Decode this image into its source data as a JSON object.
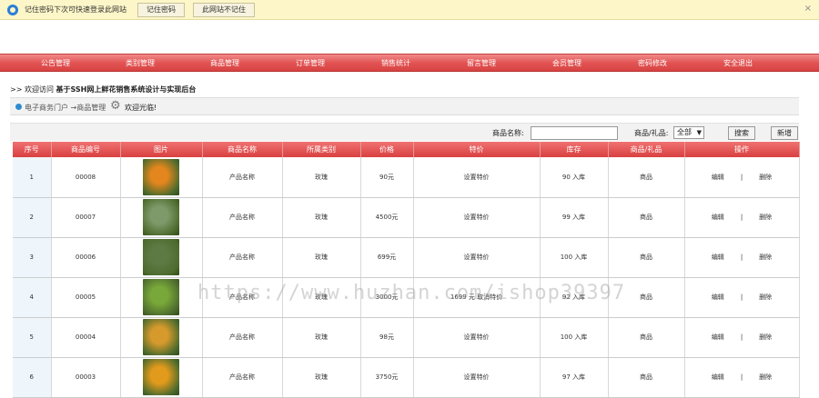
{
  "password_bar": {
    "message": "记住密码下次可快速登录此网站",
    "remember_label": "记住密码",
    "never_label": "此网站不记住",
    "close": "×"
  },
  "nav": {
    "items": [
      "公告管理",
      "类别管理",
      "商品管理",
      "订单管理",
      "销售统计",
      "留言管理",
      "会员管理",
      "密码修改",
      "安全退出"
    ]
  },
  "welcome": {
    "prefix": ">> 欢迎访问",
    "title": "基于SSH网上鲜花销售系统设计与实现后台"
  },
  "breadcrumb": {
    "path": "电子商务门户 →商品管理",
    "greeting": "欢迎光临!"
  },
  "search": {
    "name_label": "商品名称:",
    "name_value": "",
    "type_label": "商品/礼品:",
    "type_value": "全部",
    "search_button": "搜索",
    "add_button": "新增"
  },
  "table": {
    "headers": [
      "序号",
      "商品编号",
      "图片",
      "商品名称",
      "所属类别",
      "价格",
      "特价",
      "库存",
      "商品/礼品",
      "操作"
    ],
    "rows": [
      {
        "no": "1",
        "code": "00008",
        "name": "产品名称",
        "category": "玫瑰",
        "price": "90元",
        "special": "设置特价",
        "stock": "90 入库",
        "kind": "商品",
        "edit": "编辑",
        "sep": "|",
        "delete": "删除",
        "color": "#e2861d"
      },
      {
        "no": "2",
        "code": "00007",
        "name": "产品名称",
        "category": "玫瑰",
        "price": "4500元",
        "special": "设置特价",
        "stock": "99 入库",
        "kind": "商品",
        "edit": "编辑",
        "sep": "|",
        "delete": "删除",
        "color": "#7e9a6a"
      },
      {
        "no": "3",
        "code": "00006",
        "name": "产品名称",
        "category": "玫瑰",
        "price": "699元",
        "special": "设置特价",
        "stock": "100 入库",
        "kind": "商品",
        "edit": "编辑",
        "sep": "|",
        "delete": "删除",
        "color": "#5d7a44"
      },
      {
        "no": "4",
        "code": "00005",
        "name": "产品名称",
        "category": "玫瑰",
        "price": "3000元",
        "special": "1699 元 取消特价",
        "stock": "92 入库",
        "kind": "商品",
        "edit": "编辑",
        "sep": "|",
        "delete": "删除",
        "color": "#79a83a"
      },
      {
        "no": "5",
        "code": "00004",
        "name": "产品名称",
        "category": "玫瑰",
        "price": "98元",
        "special": "设置特价",
        "stock": "100 入库",
        "kind": "商品",
        "edit": "编辑",
        "sep": "|",
        "delete": "删除",
        "color": "#d69a2c"
      },
      {
        "no": "6",
        "code": "00003",
        "name": "产品名称",
        "category": "玫瑰",
        "price": "3750元",
        "special": "设置特价",
        "stock": "97 入库",
        "kind": "商品",
        "edit": "编辑",
        "sep": "|",
        "delete": "删除",
        "color": "#e29a1c"
      }
    ]
  },
  "watermark": "https://www.huzhan.com/ishop39397"
}
